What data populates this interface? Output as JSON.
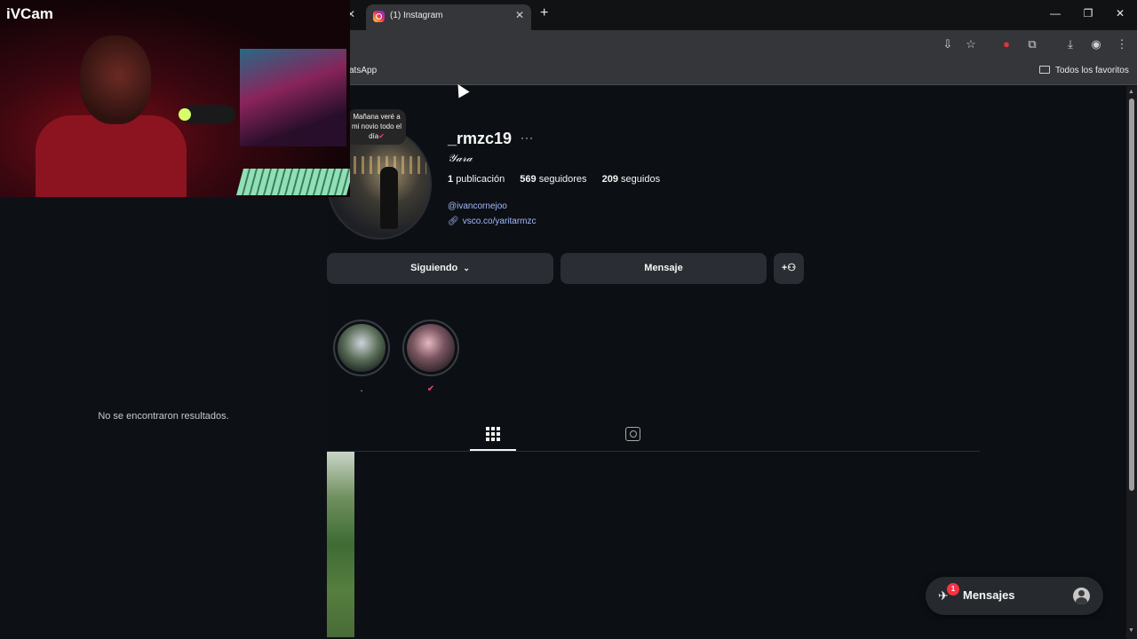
{
  "webcam": {
    "label": "iVCam"
  },
  "left_panel": {
    "empty_text": "No se encontraron resultados."
  },
  "browser": {
    "tab_title": "(1) Instagram",
    "bookmark_partial": "atsApp",
    "bookmarks_folder": "Todos los favoritos"
  },
  "profile": {
    "username": "_rmzc19",
    "full_name": "𝒴𝒶𝓇𝒶",
    "note": "Mañana veré a mi novio todo el día",
    "note_emoji": "✔",
    "stats": {
      "posts_count": "1",
      "posts_label": "publicación",
      "followers_count": "569",
      "followers_label": "seguidores",
      "following_count": "209",
      "following_label": "seguidos"
    },
    "mention": "@ivancornejoo",
    "link": "vsco.co/yaritarmzc",
    "buttons": {
      "following": "Siguiendo",
      "message": "Mensaje"
    },
    "highlights": [
      {
        "label": "."
      },
      {
        "label": "✔"
      }
    ]
  },
  "messages_bar": {
    "label": "Mensajes",
    "badge": "1"
  },
  "colors": {
    "accent_link": "#a3b8ff",
    "badge_red": "#ff3040",
    "background": "#0c1014"
  }
}
